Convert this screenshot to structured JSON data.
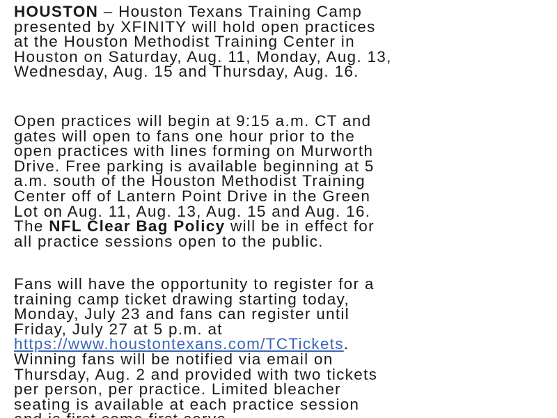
{
  "paragraph1": {
    "dateline": "HOUSTON",
    "line1_rest": " – Houston Texans Training Camp",
    "line2": "presented by XFINITY will hold open practices",
    "line3": "at the Houston Methodist Training Center in",
    "line4": "Houston on Saturday, Aug. 11, Monday, Aug. 13,",
    "line5": "Wednesday, Aug. 15 and Thursday, Aug. 16."
  },
  "paragraph2": {
    "line1": "Open practices will begin at 9:15 a.m. CT and",
    "line2": "gates will open to fans one hour prior to the",
    "line3": "open practices with lines forming on Murworth",
    "line4": "Drive. Free parking is available beginning at 5",
    "line5": "a.m. south of the Houston Methodist Training",
    "line6": "Center off of Lantern Point Drive in the Green",
    "line7": "Lot on Aug. 11, Aug. 13, Aug. 15 and Aug. 16.",
    "line8_start": "The ",
    "policy_link": "NFL Clear Bag Policy",
    "line8_end": " will be in effect for",
    "line9": "all practice sessions open to the public."
  },
  "paragraph3": {
    "line1": "Fans will have the opportunity to register for a",
    "line2": "training camp ticket drawing starting today,",
    "line3": "Monday, July 23 and fans can register until",
    "line4": "Friday, July 27 at 5 p.m. at",
    "url": "https://www.houstontexans.com/TCTickets",
    "url_suffix": ".",
    "line6": "Winning fans will be notified via email on",
    "line7": "Thursday, Aug. 2 and provided with two tickets",
    "line8": "per person, per practice. Limited bleacher",
    "line9": "seating is available at each practice session",
    "line10": "and is first come first serve."
  },
  "colors": {
    "text": "#1a1a1a",
    "link": "#3a66b8",
    "background": "#ffffff"
  }
}
